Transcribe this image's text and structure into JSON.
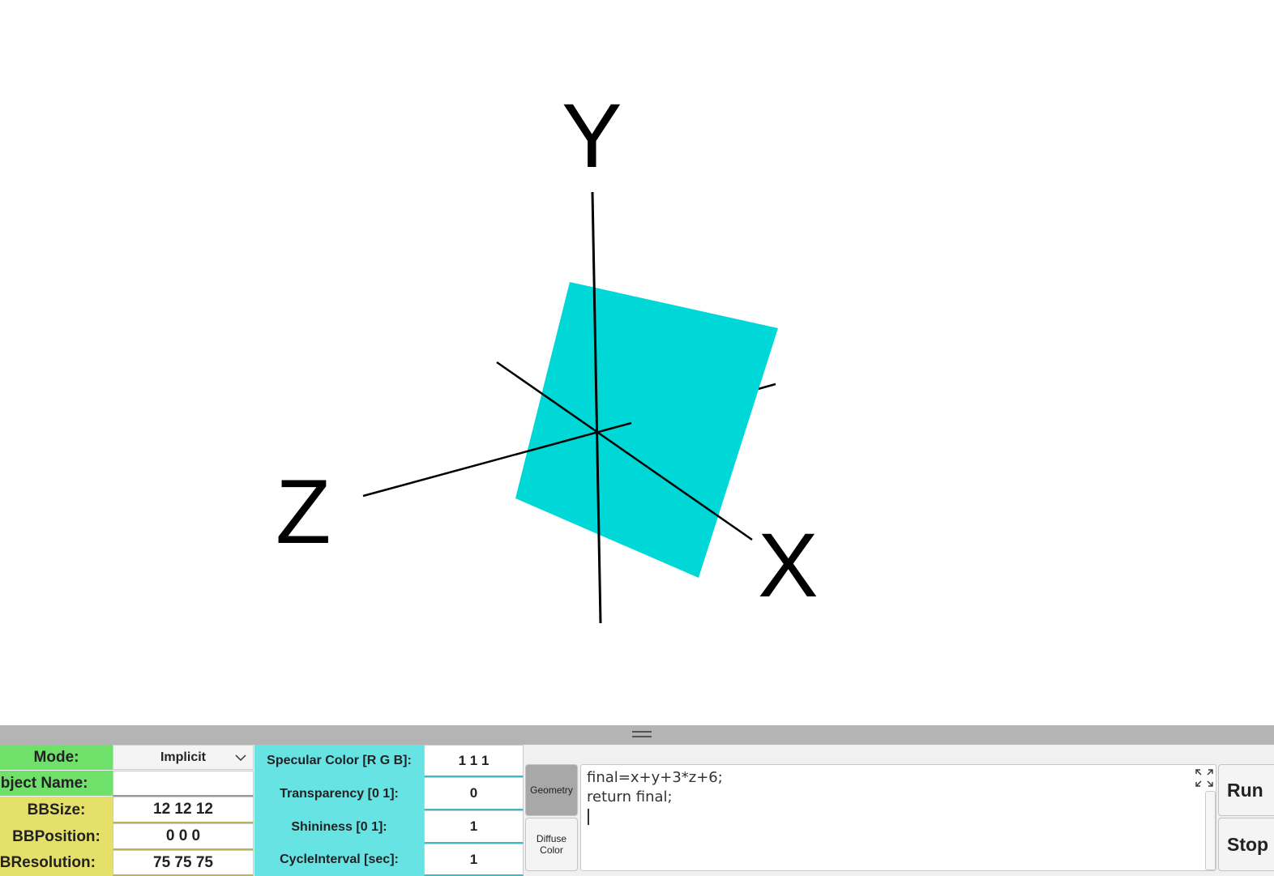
{
  "viewport": {
    "axis_labels": {
      "x": "X",
      "y": "Y",
      "z": "Z"
    },
    "surface_color": "#00d8d8",
    "axis_color": "#000000"
  },
  "panel": {
    "properties": {
      "mode_label": "Mode:",
      "mode_value": "Implicit",
      "object_name_label": "Object Name:",
      "object_name_value": "",
      "bbsize_label": "BBSize:",
      "bbsize_value": "12 12 12",
      "bbposition_label": "BBPosition:",
      "bbposition_value": "0 0 0",
      "bbresolution_label": "BBResolution:",
      "bbresolution_value": "75 75 75"
    },
    "material": {
      "specular_label": "Specular Color [R G B]:",
      "specular_value": "1 1 1",
      "transparency_label": "Transparency [0 1]:",
      "transparency_value": "0",
      "shininess_label": "Shininess [0 1]:",
      "shininess_value": "1",
      "cycle_label": "CycleInterval [sec]:",
      "cycle_value": "1"
    },
    "tabs": {
      "geometry": "Geometry",
      "diffuse_line1": "Diffuse",
      "diffuse_line2": "Color"
    },
    "editor": {
      "code": "final=x+y+3*z+6;\nreturn final;"
    },
    "buttons": {
      "run": "Run",
      "stop": "Stop"
    },
    "colors": {
      "green": "#6fe06a",
      "yellow": "#e4e06a",
      "cyan": "#67e3e4"
    }
  }
}
